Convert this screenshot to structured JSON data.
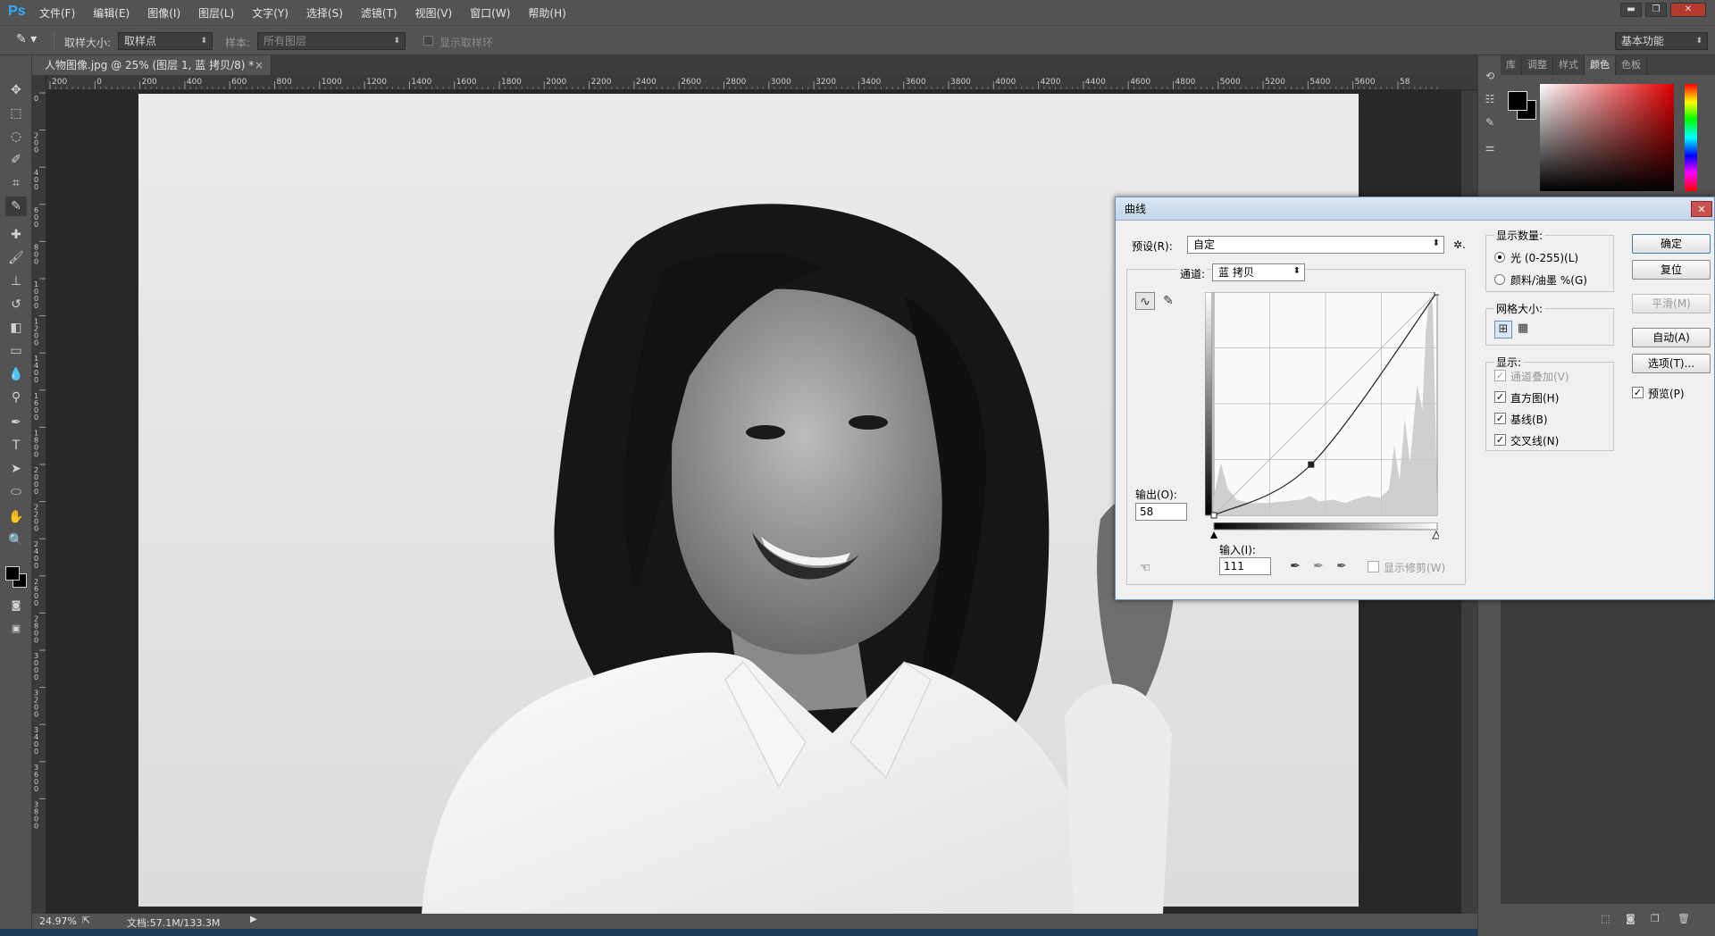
{
  "app": {
    "logo": "Ps"
  },
  "menu": [
    "文件(F)",
    "编辑(E)",
    "图像(I)",
    "图层(L)",
    "文字(Y)",
    "选择(S)",
    "滤镜(T)",
    "视图(V)",
    "窗口(W)",
    "帮助(H)"
  ],
  "window_controls": {
    "min": "▬",
    "restore": "❐",
    "close": "✕"
  },
  "options": {
    "sample_size_label": "取样大小:",
    "sample_size_value": "取样点",
    "sample_label": "样本:",
    "sample_value": "所有图层",
    "show_ring_label": "显示取样环",
    "workspace": "基本功能"
  },
  "document": {
    "tab_title": "人物图像.jpg @ 25% (图层 1, 蓝 拷贝/8) *",
    "zoom": "24.97%",
    "doc_info": "文档:57.1M/133.3M",
    "ruler_h": [
      "200",
      "0",
      "200",
      "400",
      "600",
      "800",
      "1000",
      "1200",
      "1400",
      "1600",
      "1800",
      "2000",
      "2200",
      "2400",
      "2600",
      "2800",
      "3000",
      "3200",
      "3400",
      "3600",
      "3800",
      "4000",
      "4200",
      "4400",
      "4600",
      "4800",
      "5000",
      "5200",
      "5400",
      "5600",
      "58"
    ],
    "ruler_v": [
      "0",
      "2 0 0",
      "4 0 0",
      "6 0 0",
      "8 0 0",
      "1 0 0 0",
      "1 2 0 0",
      "1 4 0 0",
      "1 6 0 0",
      "1 8 0 0",
      "2 0 0 0",
      "2 2 0 0",
      "2 4 0 0",
      "2 6 0 0",
      "2 8 0 0",
      "3 0 0 0",
      "3 2 0 0",
      "3 4 0 0",
      "3 6 0 0",
      "3 8 0 0"
    ]
  },
  "tools": [
    "move-icon",
    "marquee-icon",
    "lasso-icon",
    "quick-select-icon",
    "crop-icon",
    "eyedropper-icon",
    "healing-icon",
    "brush-icon",
    "stamp-icon",
    "history-brush-icon",
    "eraser-icon",
    "gradient-icon",
    "blur-icon",
    "dodge-icon",
    "pen-icon",
    "type-icon",
    "path-select-icon",
    "ellipse-icon",
    "hand-icon",
    "zoom-icon"
  ],
  "right_panel": {
    "tabs": [
      "库",
      "调整",
      "样式",
      "颜色",
      "色板"
    ],
    "active_tab": "颜色"
  },
  "curves": {
    "title": "曲线",
    "close": "✕",
    "preset_label": "预设(R):",
    "preset_value": "自定",
    "preset_gear": "✲.",
    "channel_label": "通道:",
    "channel_value": "蓝 拷贝",
    "output_label": "输出(O):",
    "output_value": "58",
    "input_label": "输入(I):",
    "input_value": "111",
    "show_clipping_label": "显示修剪(W)",
    "display_amount_title": "显示数量:",
    "light_label": "光 (0-255)(L)",
    "pigment_label": "颜料/油墨 %(G)",
    "grid_size_title": "网格大小:",
    "show_title": "显示:",
    "channel_overlay_label": "通道叠加(V)",
    "histogram_label": "直方图(H)",
    "baseline_label": "基线(B)",
    "intersection_label": "交叉线(N)",
    "buttons": {
      "ok": "确定",
      "reset": "复位",
      "smooth": "平滑(M)",
      "auto": "自动(A)",
      "options": "选项(T)...",
      "preview": "预览(P)"
    },
    "curve_points": [
      [
        0,
        0
      ],
      [
        111,
        58
      ],
      [
        255,
        255
      ]
    ]
  }
}
